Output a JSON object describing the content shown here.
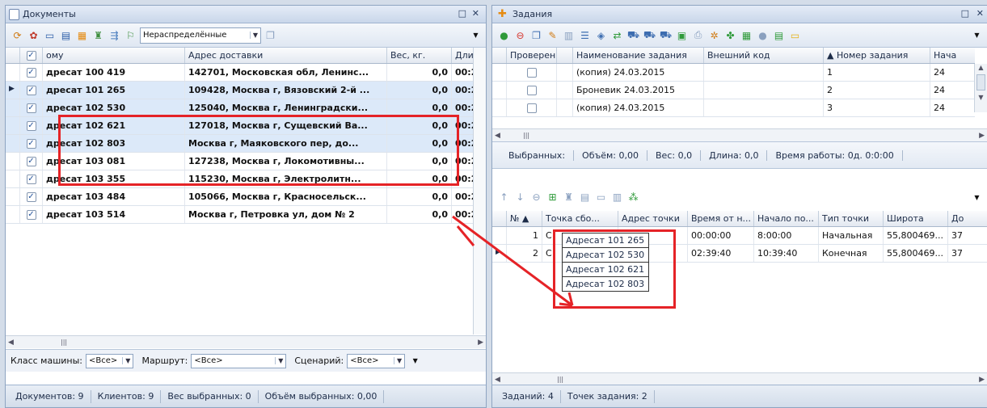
{
  "left": {
    "title": "Документы",
    "filter_value": "Нераспределённые",
    "columns": [
      "",
      "ому",
      "Адрес доставки",
      "Вес, кг.",
      "Длит"
    ],
    "rows": [
      {
        "checked": true,
        "name": "дресат 100 419",
        "addr": "142701, Московская обл, Ленинс...",
        "weight": "0,0",
        "dur": "00:2"
      },
      {
        "checked": true,
        "name": "дресат 101 265",
        "addr": "109428, Москва г, Вязовский 2-й ...",
        "weight": "0,0",
        "dur": "00:2"
      },
      {
        "checked": true,
        "name": "дресат 102 530",
        "addr": "125040, Москва г, Ленинградски...",
        "weight": "0,0",
        "dur": "00:2"
      },
      {
        "checked": true,
        "name": "дресат 102 621",
        "addr": "127018, Москва г, Сущевский Ва...",
        "weight": "0,0",
        "dur": "00:2"
      },
      {
        "checked": true,
        "name": "дресат 102 803",
        "addr": "Москва г, Маяковского пер, до...",
        "weight": "0,0",
        "dur": "00:2"
      },
      {
        "checked": true,
        "name": "дресат 103 081",
        "addr": "127238, Москва г, Локомотивны...",
        "weight": "0,0",
        "dur": "00:2"
      },
      {
        "checked": true,
        "name": "дресат 103 355",
        "addr": "115230, Москва г, Электролитн...",
        "weight": "0,0",
        "dur": "00:2"
      },
      {
        "checked": true,
        "name": "дресат 103 484",
        "addr": "105066, Москва г, Красносельск...",
        "weight": "0,0",
        "dur": "00:2"
      },
      {
        "checked": true,
        "name": "дресат 103 514",
        "addr": "Москва г, Петровка ул, дом № 2",
        "weight": "0,0",
        "dur": "00:2"
      }
    ],
    "filters": {
      "car_class_label": "Класс машины:",
      "car_class_value": "<Все>",
      "route_label": "Маршрут:",
      "route_value": "<Все>",
      "scenario_label": "Сценарий:",
      "scenario_value": "<Все>"
    },
    "status": {
      "docs": "Документов: 9",
      "clients": "Клиентов: 9",
      "weight": "Вес выбранных: 0",
      "volume": "Объём выбранных: 0,00"
    }
  },
  "right": {
    "title": "Задания",
    "columns": [
      "Проверен",
      "",
      "Наименование задания",
      "Внешний код",
      "▲ Номер задания",
      "Нача"
    ],
    "tasks": [
      {
        "checked": false,
        "name": "(копия) 24.03.2015",
        "code": "",
        "number": "1",
        "start": "24"
      },
      {
        "checked": false,
        "name": "Броневик 24.03.2015",
        "code": "",
        "number": "2",
        "start": "24"
      },
      {
        "checked": false,
        "name": "(копия) 24.03.2015",
        "code": "",
        "number": "3",
        "start": "24"
      }
    ],
    "info": {
      "selected": "Выбранных:",
      "volume": "Объём: 0,00",
      "weight": "Вес: 0,0",
      "length": "Длина: 0,0",
      "work_time": "Время работы: 0д. 0:0:00"
    },
    "points_columns": [
      "",
      "№ ▲",
      "Точка сбо...",
      "Адрес точки",
      "Время от н...",
      "Начало по...",
      "Тип точки",
      "Широта",
      "До"
    ],
    "points": [
      {
        "num": "1",
        "point": "С",
        "addr": "",
        "time": "00:00:00",
        "start": "8:00:00",
        "type": "Начальная",
        "lat": "55,800469...",
        "lon": "37"
      },
      {
        "num": "2",
        "point": "С",
        "addr": "",
        "time": "02:39:40",
        "start": "10:39:40",
        "type": "Конечная",
        "lat": "55,800469...",
        "lon": "37"
      }
    ],
    "status": {
      "tasks": "Заданий: 4",
      "points": "Точек задания: 2"
    }
  },
  "popup_items": [
    "Адресат 101 265",
    "Адресат 102 530",
    "Адресат 102 621",
    "Адресат 102 803"
  ],
  "colors": {
    "accent": "#e52327",
    "selection": "#dce9f9"
  }
}
